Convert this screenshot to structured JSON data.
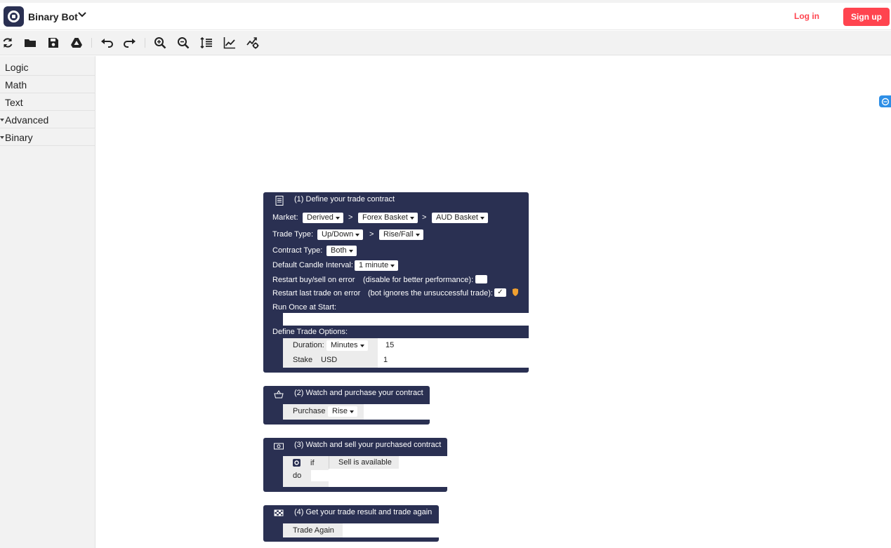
{
  "header": {
    "brand": "Binary Bot",
    "login_label": "Log in",
    "signup_label": "Sign up"
  },
  "toolbar": {
    "buttons": [
      "reset-icon",
      "open-folder-icon",
      "save-icon",
      "google-drive-icon",
      "undo-icon",
      "redo-icon",
      "zoom-in-icon",
      "zoom-out-icon",
      "rearrange-icon",
      "chart-icon",
      "trading-view-icon"
    ]
  },
  "sidebar": {
    "items": [
      {
        "label": "Logic",
        "expandable": false
      },
      {
        "label": "Math",
        "expandable": false
      },
      {
        "label": "Text",
        "expandable": false
      },
      {
        "label": "Advanced",
        "expandable": true
      },
      {
        "label": "Binary",
        "expandable": true
      }
    ]
  },
  "colors": {
    "accent": "#ff444f",
    "block_bg": "#2a3052",
    "toolbar_bg": "#f2f2f2"
  },
  "blocks": {
    "trade": {
      "title": "(1) Define your trade contract",
      "market_label": "Market:",
      "market_values": [
        "Derived",
        "Forex Basket",
        "AUD Basket"
      ],
      "separator": ">",
      "trade_type_label": "Trade Type:",
      "trade_type_values": [
        "Up/Down",
        "Rise/Fall"
      ],
      "contract_type_label": "Contract Type:",
      "contract_type_value": "Both",
      "candle_label": "Default Candle Interval:",
      "candle_value": "1 minute",
      "restart_buy_label": "Restart buy/sell on error",
      "restart_buy_hint": "(disable for better performance):",
      "restart_last_label": "Restart last trade on error",
      "restart_last_hint": "(bot ignores the unsuccessful trade):",
      "restart_last_checked": "✓",
      "run_once_label": "Run Once at Start:",
      "trade_options_label": "Define Trade Options:",
      "duration_label": "Duration:",
      "duration_unit": "Minutes",
      "duration_value": "15",
      "stake_label": "Stake",
      "stake_currency": "USD",
      "stake_value": "1"
    },
    "purchase": {
      "title": "(2) Watch and purchase your contract",
      "purchase_label": "Purchase",
      "purchase_value": "Rise"
    },
    "sell": {
      "title": "(3) Watch and sell your purchased contract",
      "if_label": "if",
      "condition": "Sell is available",
      "do_label": "do"
    },
    "result": {
      "title": "(4) Get your trade result and trade again",
      "trade_again": "Trade Again"
    }
  }
}
